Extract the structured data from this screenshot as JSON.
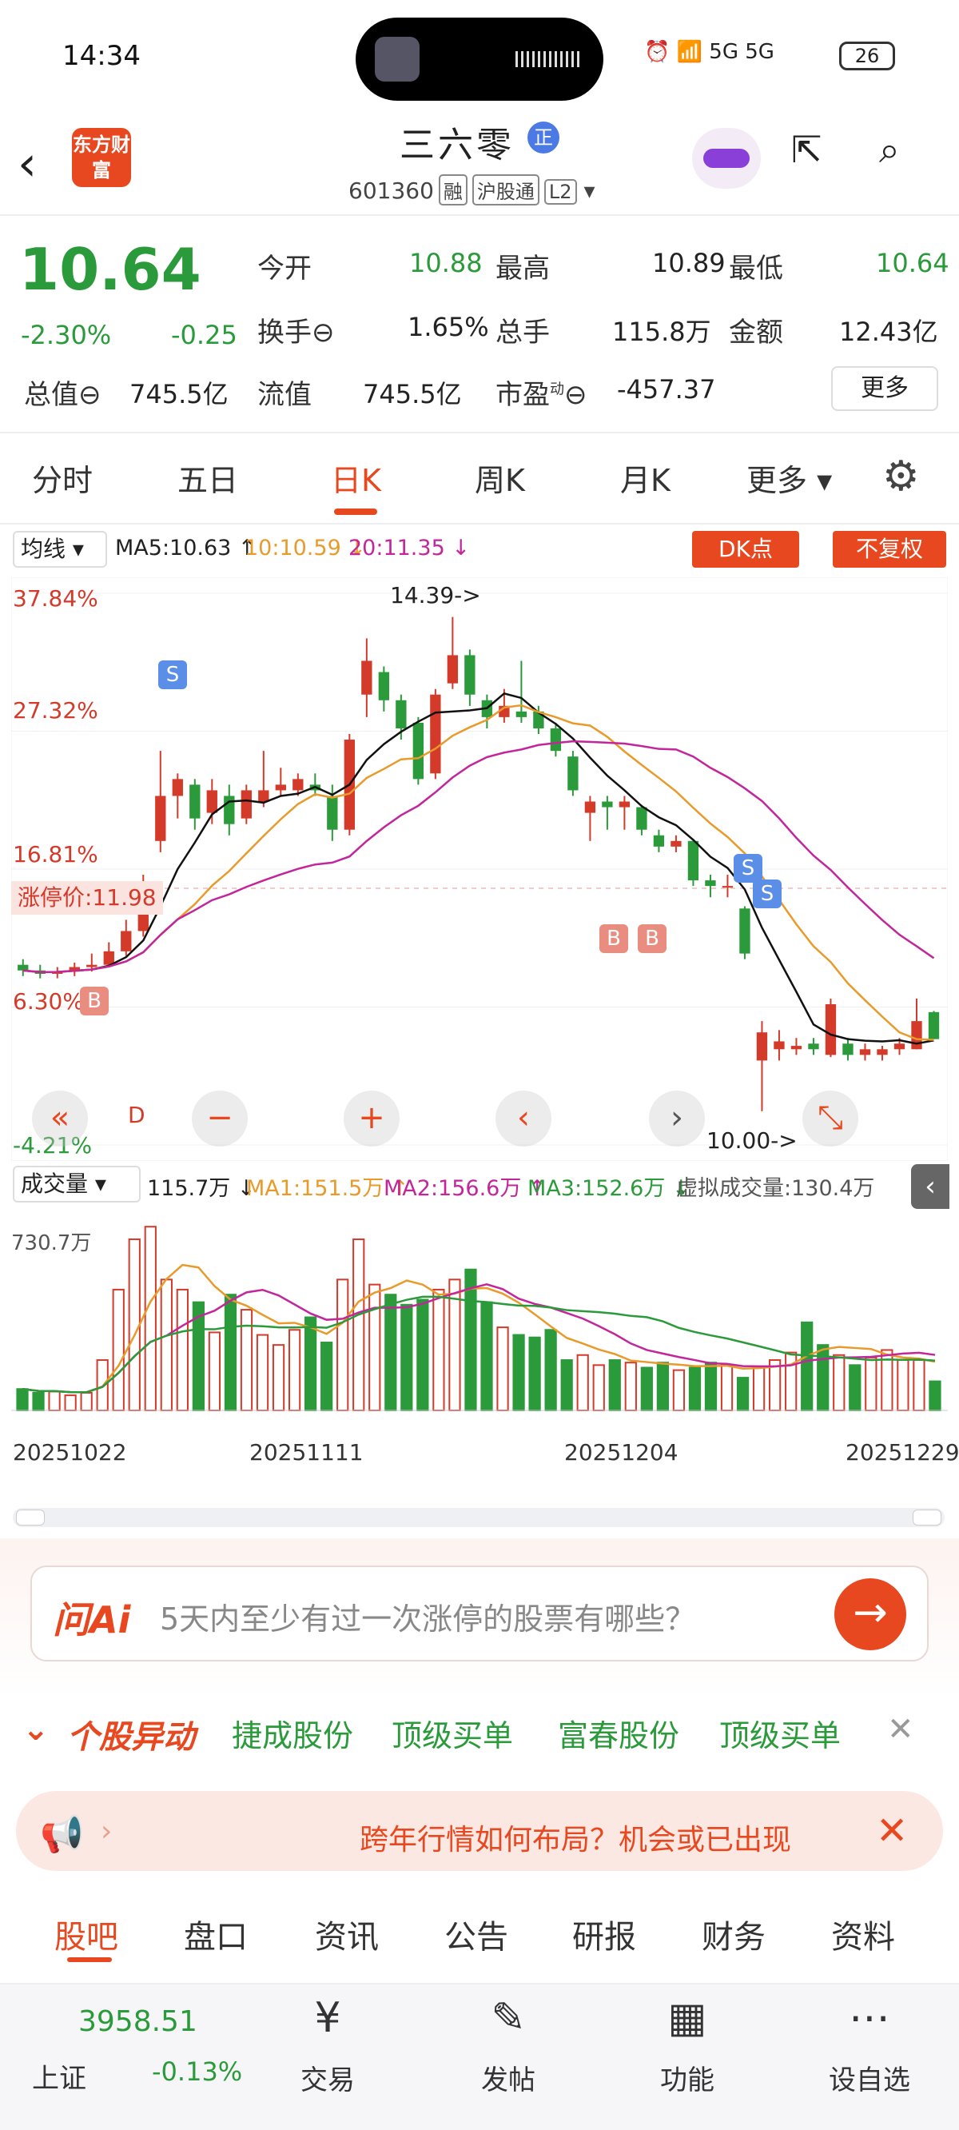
{
  "status": {
    "time": "14:34",
    "signal": "5G 5G",
    "battery": "26"
  },
  "header": {
    "stock_name": "三六零",
    "badge": "正",
    "code": "601360",
    "tags": [
      "融",
      "沪股通",
      "L2"
    ],
    "logo_text": "东方财富"
  },
  "quote": {
    "price": "10.64",
    "change_pct": "-2.30%",
    "change": "-0.25",
    "open_label": "今开",
    "open": "10.88",
    "high_label": "最高",
    "high": "10.89",
    "low_label": "最低",
    "low": "10.64",
    "turnover_label": "换手",
    "turnover": "1.65%",
    "volume_label": "总手",
    "volume": "115.8万",
    "amount_label": "金额",
    "amount": "12.43亿",
    "total_mv_label": "总值",
    "total_mv": "745.5亿",
    "float_mv_label": "流值",
    "float_mv": "745.5亿",
    "pe_label": "市盈",
    "pe_sup": "动",
    "pe": "-457.37",
    "more": "更多"
  },
  "tabs": [
    "分时",
    "五日",
    "日K",
    "周K",
    "月K",
    "更多"
  ],
  "ma": {
    "select": "均线",
    "ma5": "MA5:10.63 ↑",
    "ma10": "10:10.59 ↓",
    "ma20": "20:11.35 ↓",
    "dk_btn": "DK点",
    "fq_btn": "不复权"
  },
  "chart_labels": {
    "y1": "37.84%",
    "y2": "27.32%",
    "y3": "16.81%",
    "y4": "6.30%",
    "y5": "-4.21%",
    "limit": "涨停价:11.98",
    "max": "14.39->",
    "min": "10.00->",
    "d_mark": "D"
  },
  "volume_bar": {
    "select": "成交量",
    "vol": "115.7万 ↓",
    "ma1": "MA1:151.5万 ↑",
    "ma2": "MA2:156.6万 ↑",
    "ma3": "MA3:152.6万 ↓",
    "virtual": "虚拟成交量:130.4万",
    "ymax": "730.7万"
  },
  "dates": [
    "20251022",
    "20251111",
    "20251204",
    "20251229"
  ],
  "ai": {
    "label": "问Ai",
    "text": "5天内至少有过一次涨停的股票有哪些？"
  },
  "anomaly": {
    "title": "个股异动",
    "items": [
      "捷成股份",
      "顶级买单",
      "富春股份",
      "顶级买单"
    ]
  },
  "ad": {
    "text": "跨年行情如何布局？机会或已出现"
  },
  "sub_tabs": [
    "股吧",
    "盘口",
    "资讯",
    "公告",
    "研报",
    "财务",
    "资料"
  ],
  "bottom": {
    "index_value": "3958.51",
    "index_name": "上证",
    "index_chg": "-0.13%",
    "items": [
      "交易",
      "发帖",
      "功能",
      "设自选"
    ]
  },
  "colors": {
    "accent": "#e8481f",
    "up": "#d43a2a",
    "down": "#2a9a3a"
  },
  "chart_data": {
    "type": "candlestick",
    "ylim": [
      10.0,
      14.39
    ],
    "candles": [
      [
        11.3,
        11.25,
        11.35,
        11.2
      ],
      [
        11.25,
        11.22,
        11.3,
        11.18
      ],
      [
        11.22,
        11.24,
        11.28,
        11.18
      ],
      [
        11.24,
        11.28,
        11.32,
        11.2
      ],
      [
        11.28,
        11.3,
        11.4,
        11.24
      ],
      [
        11.3,
        11.42,
        11.5,
        11.28
      ],
      [
        11.42,
        11.6,
        11.7,
        11.38
      ],
      [
        11.6,
        11.98,
        12.1,
        11.55
      ],
      [
        12.4,
        12.8,
        13.2,
        12.3
      ],
      [
        12.8,
        12.95,
        13.0,
        12.6
      ],
      [
        12.9,
        12.6,
        12.95,
        12.5
      ],
      [
        12.65,
        12.85,
        12.95,
        12.55
      ],
      [
        12.8,
        12.55,
        12.9,
        12.45
      ],
      [
        12.6,
        12.85,
        12.9,
        12.55
      ],
      [
        12.75,
        12.85,
        13.2,
        12.7
      ],
      [
        12.85,
        12.9,
        13.05,
        12.8
      ],
      [
        12.85,
        12.95,
        13.0,
        12.8
      ],
      [
        12.9,
        12.85,
        13.0,
        12.8
      ],
      [
        12.8,
        12.5,
        12.9,
        12.4
      ],
      [
        12.5,
        13.3,
        13.35,
        12.45
      ],
      [
        13.7,
        14.0,
        14.2,
        13.5
      ],
      [
        13.9,
        13.65,
        13.95,
        13.55
      ],
      [
        13.65,
        13.4,
        13.7,
        13.3
      ],
      [
        13.45,
        12.95,
        13.5,
        12.9
      ],
      [
        13.0,
        13.7,
        13.75,
        12.95
      ],
      [
        13.8,
        14.05,
        14.39,
        13.75
      ],
      [
        14.05,
        13.7,
        14.1,
        13.6
      ],
      [
        13.65,
        13.5,
        13.7,
        13.4
      ],
      [
        13.5,
        13.6,
        13.75,
        13.45
      ],
      [
        13.55,
        13.5,
        14.0,
        13.45
      ],
      [
        13.55,
        13.4,
        13.6,
        13.35
      ],
      [
        13.4,
        13.2,
        13.45,
        13.15
      ],
      [
        13.15,
        12.85,
        13.2,
        12.8
      ],
      [
        12.65,
        12.75,
        12.8,
        12.4
      ],
      [
        12.75,
        12.7,
        12.8,
        12.5
      ],
      [
        12.7,
        12.75,
        12.8,
        12.5
      ],
      [
        12.7,
        12.5,
        12.72,
        12.45
      ],
      [
        12.45,
        12.35,
        12.5,
        12.3
      ],
      [
        12.35,
        12.4,
        12.45,
        12.3
      ],
      [
        12.4,
        12.05,
        12.42,
        12.0
      ],
      [
        12.05,
        12.0,
        12.1,
        11.9
      ],
      [
        12.0,
        12.0,
        12.1,
        11.9
      ],
      [
        11.8,
        11.4,
        11.82,
        11.35
      ],
      [
        10.45,
        10.7,
        10.8,
        10.0
      ],
      [
        10.55,
        10.62,
        10.72,
        10.45
      ],
      [
        10.55,
        10.58,
        10.65,
        10.5
      ],
      [
        10.6,
        10.55,
        10.65,
        10.5
      ],
      [
        10.5,
        10.95,
        11.0,
        10.48
      ],
      [
        10.6,
        10.5,
        10.65,
        10.45
      ],
      [
        10.5,
        10.55,
        10.6,
        10.45
      ],
      [
        10.5,
        10.55,
        10.58,
        10.45
      ],
      [
        10.55,
        10.6,
        10.65,
        10.5
      ],
      [
        10.55,
        10.8,
        11.0,
        10.55
      ],
      [
        10.88,
        10.64,
        10.89,
        10.64
      ]
    ],
    "volumes": [
      85,
      70,
      75,
      60,
      70,
      200,
      480,
      680,
      730,
      520,
      480,
      430,
      310,
      460,
      400,
      300,
      260,
      320,
      370,
      270,
      520,
      680,
      500,
      460,
      420,
      440,
      480,
      520,
      560,
      430,
      330,
      300,
      290,
      320,
      200,
      220,
      180,
      200,
      190,
      170,
      190,
      160,
      170,
      190,
      180,
      130,
      170,
      200,
      230,
      350,
      260,
      220,
      180,
      210,
      240,
      200,
      200,
      115.7
    ]
  }
}
